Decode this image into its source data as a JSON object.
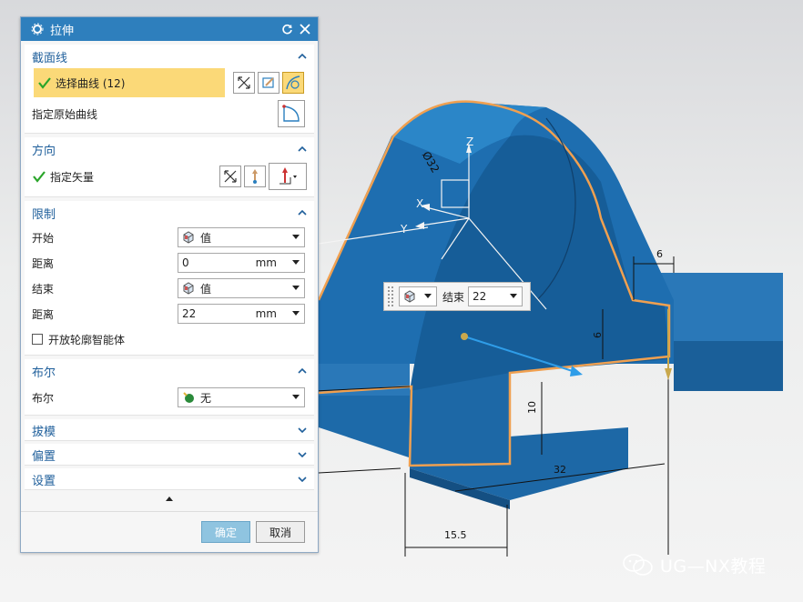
{
  "dialog": {
    "title": "拉伸",
    "sections": {
      "section_curve": {
        "title": "截面线",
        "select_curve": "选择曲线 (12)",
        "origin_curve": "指定原始曲线"
      },
      "direction": {
        "title": "方向",
        "vector": "指定矢量"
      },
      "limits": {
        "title": "限制",
        "start_label": "开始",
        "start_value": "值",
        "start_dist_label": "距离",
        "start_dist_value": "0",
        "end_label": "结束",
        "end_value": "值",
        "end_dist_label": "距离",
        "end_dist_value": "22",
        "unit": "mm",
        "open_profile": "开放轮廓智能体"
      },
      "boolean": {
        "title": "布尔",
        "label": "布尔",
        "value": "无"
      },
      "draft": {
        "title": "拔模"
      },
      "offset": {
        "title": "偏置"
      },
      "settings": {
        "title": "设置"
      }
    },
    "ok_label": "确定",
    "cancel_label": "取消"
  },
  "popup": {
    "label": "结束",
    "value": "22"
  },
  "model_dims": {
    "diameter": "Ø32",
    "d6_top": "6",
    "d6_side": "6",
    "d10": "10",
    "d32": "32",
    "d15_5": "15.5"
  },
  "axes": {
    "z": "Z",
    "x": "X",
    "y": "Y"
  },
  "watermark": "UG—NX教程",
  "colors": {
    "title_bar": "#2e7fbd",
    "section_title": "#1f5f9b",
    "highlight": "#fbd978",
    "model_blue": "#1f6aa8",
    "edge_orange": "#f0a050",
    "check_green": "#2aa52a"
  }
}
